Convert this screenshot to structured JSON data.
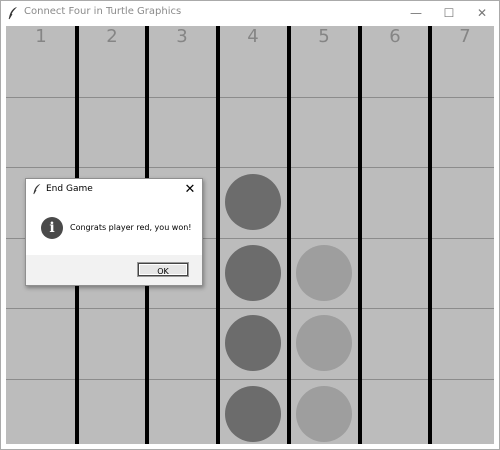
{
  "window": {
    "title": "Connect Four in Turtle Graphics",
    "minimize_glyph": "—",
    "maximize_glyph": "☐",
    "close_glyph": "✕",
    "icon": "feather-icon"
  },
  "board": {
    "columns": [
      "1",
      "2",
      "3",
      "4",
      "5",
      "6",
      "7"
    ],
    "rows": 6,
    "background": "#bcbcbc",
    "colors": {
      "red": "#6c6c6c",
      "yellow": "#9e9e9e"
    },
    "discs": [
      {
        "col": 4,
        "row": 3,
        "player": "red"
      },
      {
        "col": 4,
        "row": 4,
        "player": "red"
      },
      {
        "col": 4,
        "row": 5,
        "player": "red"
      },
      {
        "col": 4,
        "row": 6,
        "player": "red"
      },
      {
        "col": 5,
        "row": 4,
        "player": "yellow"
      },
      {
        "col": 5,
        "row": 5,
        "player": "yellow"
      },
      {
        "col": 5,
        "row": 6,
        "player": "yellow"
      }
    ]
  },
  "dialog": {
    "title": "End Game",
    "close_glyph": "✕",
    "icon": "info-icon",
    "icon_glyph": "i",
    "message": "Congrats player red, you won!",
    "ok_label": "OK"
  }
}
